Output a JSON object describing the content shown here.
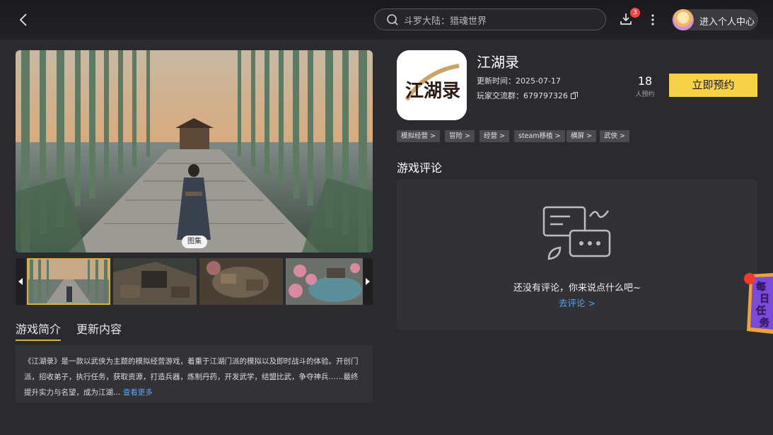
{
  "search": {
    "placeholder": "斗罗大陆：猎魂世界"
  },
  "header": {
    "download_badge": "3",
    "user_label": "进入个人中心"
  },
  "gallery": {
    "tag_label": "图集",
    "thumb_count": 4
  },
  "game": {
    "title": "江湖录",
    "update_label": "更新时间：",
    "update_date": "2025-07-17",
    "group_label": "玩家交流群：",
    "group_number": "679797326",
    "reserve_count": "18",
    "reserve_count_label": "人预约",
    "reserve_button": "立即预约",
    "icon_text": "江湖录"
  },
  "tags": [
    "模拟经营 >",
    "冒险 >",
    "经营 >",
    "steam移植 >",
    "横屏 >",
    "武侠 >"
  ],
  "tabs": [
    {
      "label": "游戏简介",
      "active": true
    },
    {
      "label": "更新内容",
      "active": false
    }
  ],
  "description": {
    "text": "《江湖录》是一款以武侠为主题的模拟经营游戏，着重于江湖门派的模拟以及即时战斗的体验。开创门派，招收弟子，执行任务，获取资源，打造兵器，炼制丹药，开发武学，结盟比武，争夺神兵……最终提升实力与名望，成为江湖…",
    "more": "查看更多"
  },
  "reviews": {
    "heading": "游戏评论",
    "empty_text": "还没有评论，你来说点什么吧~",
    "cta": "去评论 >"
  },
  "daily_task": {
    "label": "每日任务"
  },
  "colors": {
    "accent": "#f7d148",
    "link": "#5aa2f2",
    "background": "#2b2b2f",
    "badge": "#f04848"
  }
}
